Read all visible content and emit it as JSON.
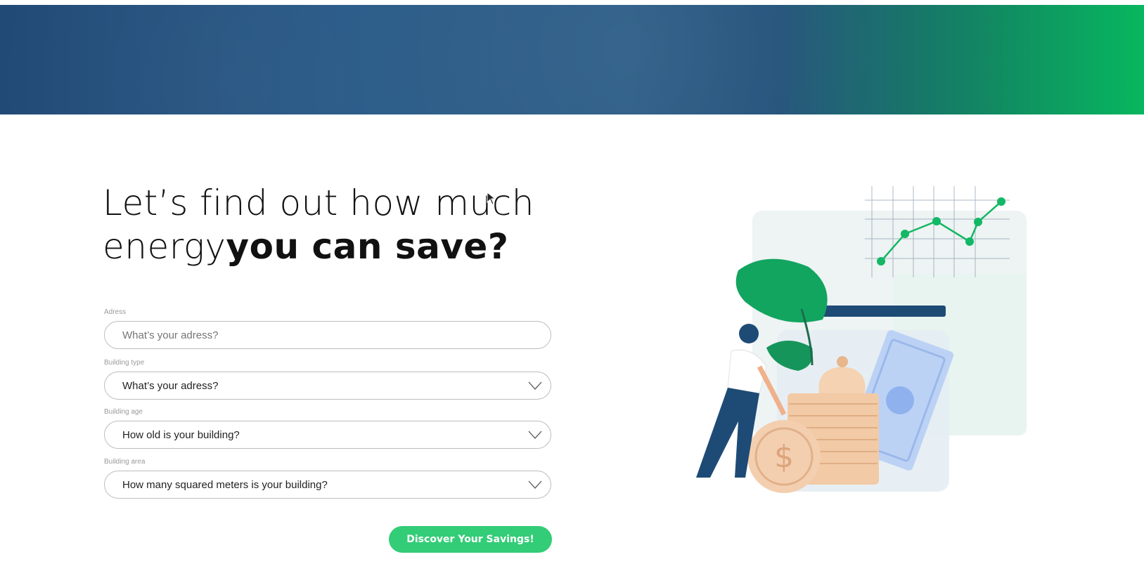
{
  "hero": {
    "gradient_start": "#1f4775",
    "gradient_end": "#07b75e"
  },
  "heading": {
    "line1": "Let’s find out how much",
    "line2_light": "energy",
    "line2_bold": "you can save?"
  },
  "form": {
    "address": {
      "label": "Adress",
      "placeholder": "What’s your adress?"
    },
    "building_type": {
      "label": "Building type",
      "value": "What’s your adress?"
    },
    "building_age": {
      "label": "Building age",
      "value": "How old is your building?"
    },
    "building_area": {
      "label": "Building area",
      "value": "How many squared meters is your building?"
    },
    "submit_label": "Discover Your Savings!"
  },
  "colors": {
    "accent": "#33cc77",
    "navy": "#1f4775",
    "green": "#07b75e"
  },
  "icons": [
    "chevron-down-icon",
    "cursor-icon"
  ]
}
